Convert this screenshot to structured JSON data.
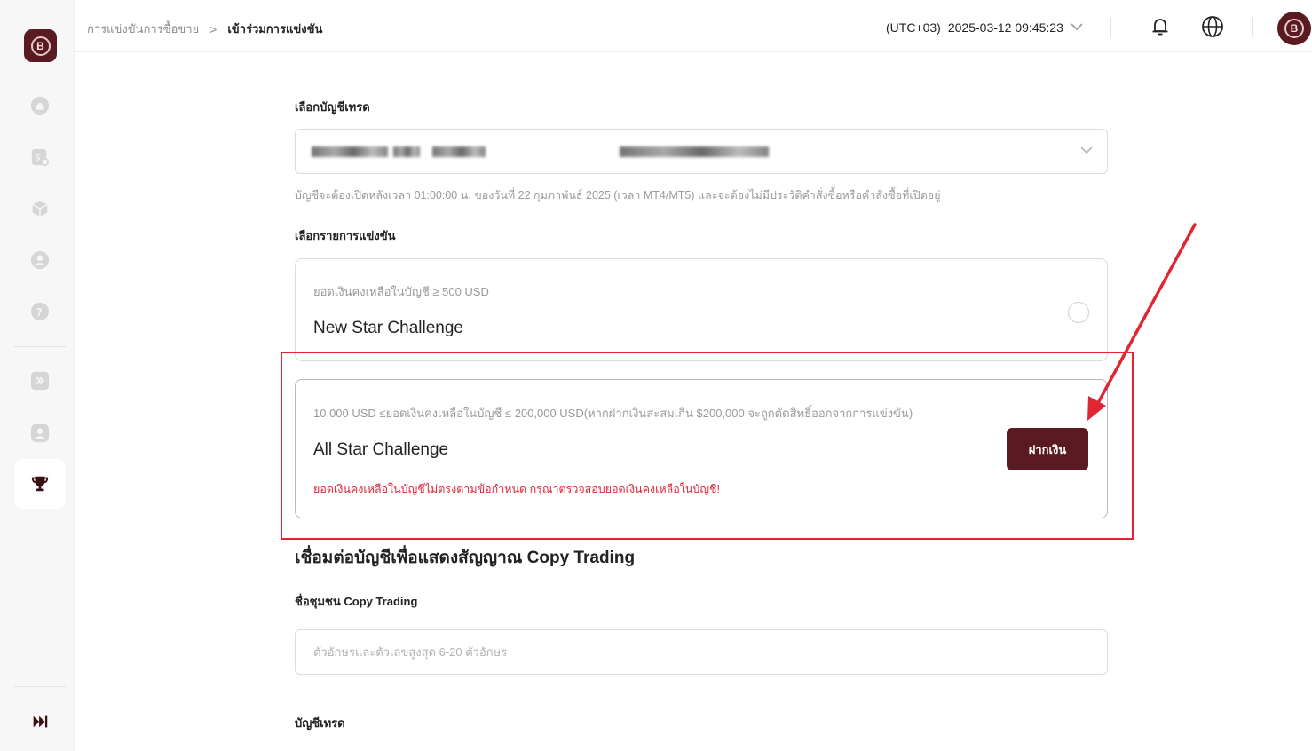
{
  "sidebar": {
    "logo_text": "B",
    "items": [
      {
        "name": "home",
        "icon": "home-icon"
      },
      {
        "name": "funds",
        "icon": "dollar-card-icon"
      },
      {
        "name": "products",
        "icon": "cube-icon"
      },
      {
        "name": "profile",
        "icon": "user-circle-icon"
      },
      {
        "name": "help",
        "icon": "help-icon"
      },
      {
        "name": "forward",
        "icon": "double-chevron-icon"
      },
      {
        "name": "account",
        "icon": "user-card-icon"
      },
      {
        "name": "competition",
        "icon": "trophy-icon",
        "active": true
      }
    ],
    "collapse_icon": "skip-forward-icon"
  },
  "header": {
    "breadcrumb_parent": "การแข่งขันการซื้อขาย",
    "breadcrumb_sep": ">",
    "breadcrumb_current": "เข้าร่วมการแข่งขัน",
    "timezone": "(UTC+03)",
    "datetime": "2025-03-12 09:45:23",
    "avatar_text": "B"
  },
  "form": {
    "account_label": "เลือกบัญชีเทรด",
    "account_hint": "บัญชีจะต้องเปิดหลังเวลา 01:00:00 น. ของวันที่ 22 กุมภาพันธ์ 2025 (เวลา MT4/MT5) และจะต้องไม่มีประวัติคำสั่งซื้อหรือคำสั่งซื้อที่เปิดอยู่",
    "competition_label": "เลือกรายการแข่งขัน",
    "challenges": [
      {
        "requirement": "ยอดเงินคงเหลือในบัญชี ≥ 500 USD",
        "title": "New Star Challenge"
      },
      {
        "requirement": "10,000 USD ≤ยอดเงินคงเหลือในบัญชี ≤ 200,000 USD(หากฝากเงินสะสมเกิน $200,000 จะถูกตัดสิทธิ์ออกจากการแข่งขัน)",
        "title": "All Star Challenge",
        "error": "ยอดเงินคงเหลือในบัญชีไม่ตรงตามข้อกำหนด กรุณาตรวจสอบยอดเงินคงเหลือในบัญชี!",
        "button": "ฝากเงิน"
      }
    ],
    "copy_section_title": "เชื่อมต่อบัญชีเพื่อแสดงสัญญาณ Copy Trading",
    "community_label": "ชื่อชุมชน Copy Trading",
    "community_placeholder": "ตัวอักษรและตัวเลขสูงสุด 6-20 ตัวอักษร",
    "trade_account_label": "บัญชีเทรด"
  },
  "colors": {
    "brand": "#5a1a22",
    "error": "#e0263a",
    "annotation": "#e02633"
  }
}
